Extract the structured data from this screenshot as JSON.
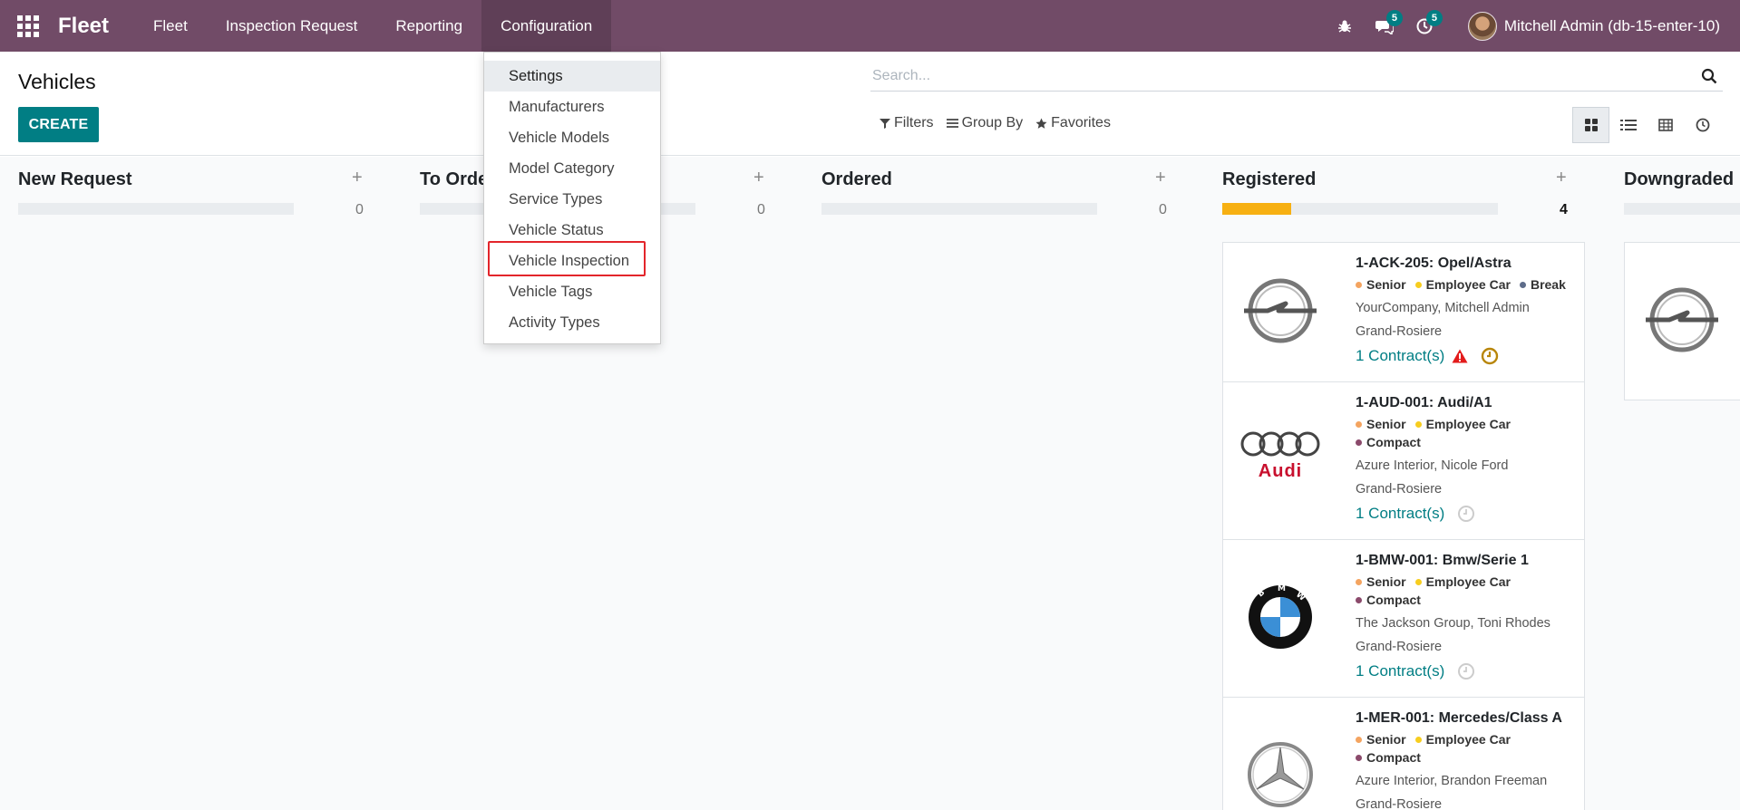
{
  "navbar": {
    "brand": "Fleet",
    "menu": [
      "Fleet",
      "Inspection Request",
      "Reporting",
      "Configuration"
    ],
    "messages_badge": "5",
    "activities_badge": "5",
    "user": "Mitchell Admin (db-15-enter-10)"
  },
  "control_panel": {
    "title": "Vehicles",
    "create_label": "CREATE",
    "search_placeholder": "Search...",
    "filters_label": "Filters",
    "groupby_label": "Group By",
    "favorites_label": "Favorites"
  },
  "dropdown": {
    "items": [
      "Settings",
      "Manufacturers",
      "Vehicle Models",
      "Model Category",
      "Service Types",
      "Vehicle Status",
      "Vehicle Inspection",
      "Vehicle Tags",
      "Activity Types"
    ],
    "hovered_item": "Settings",
    "highlighted_item": "Vehicle Inspection"
  },
  "columns": [
    {
      "title": "New Request",
      "count": "0",
      "progress": 0
    },
    {
      "title": "To Order",
      "count": "0",
      "progress": 0
    },
    {
      "title": "Ordered",
      "count": "0",
      "progress": 0
    },
    {
      "title": "Registered",
      "count": "4",
      "progress": 0.25
    },
    {
      "title": "Downgraded",
      "count": "",
      "progress": 0
    }
  ],
  "cards": [
    {
      "name": "1-ACK-205: Opel/Astra",
      "tags": [
        {
          "label": "Senior",
          "color": "#F4A460"
        },
        {
          "label": "Employee Car",
          "color": "#F7CD1F"
        },
        {
          "label": "Break",
          "color": "#5E6C8A"
        }
      ],
      "owner": "YourCompany, Mitchell Admin",
      "location": "Grand-Rosiere",
      "contracts": "1 Contract(s)",
      "brand_logo": "opel-logo"
    },
    {
      "name": "1-AUD-001: Audi/A1",
      "tags": [
        {
          "label": "Senior",
          "color": "#F4A460"
        },
        {
          "label": "Employee Car",
          "color": "#F7CD1F"
        },
        {
          "label": "Compact",
          "color": "#8B4A6B"
        }
      ],
      "owner": "Azure Interior, Nicole Ford",
      "location": "Grand-Rosiere",
      "contracts": "1 Contract(s)",
      "brand_logo": "audi-logo",
      "brand_text": "Audi"
    },
    {
      "name": "1-BMW-001: Bmw/Serie 1",
      "tags": [
        {
          "label": "Senior",
          "color": "#F4A460"
        },
        {
          "label": "Employee Car",
          "color": "#F7CD1F"
        },
        {
          "label": "Compact",
          "color": "#8B4A6B"
        }
      ],
      "owner": "The Jackson Group, Toni Rhodes",
      "location": "Grand-Rosiere",
      "contracts": "1 Contract(s)",
      "brand_logo": "bmw-logo"
    },
    {
      "name": "1-MER-001: Mercedes/Class A",
      "tags": [
        {
          "label": "Senior",
          "color": "#F4A460"
        },
        {
          "label": "Employee Car",
          "color": "#F7CD1F"
        },
        {
          "label": "Compact",
          "color": "#8B4A6B"
        }
      ],
      "owner": "Azure Interior, Brandon Freeman",
      "location": "Grand-Rosiere",
      "contracts": "",
      "brand_logo": "mercedes-logo"
    }
  ],
  "colors": {
    "navbar": "#714B67",
    "primary": "#017E84",
    "progress_fill": "#F7B012",
    "highlight": "#E3252B"
  }
}
